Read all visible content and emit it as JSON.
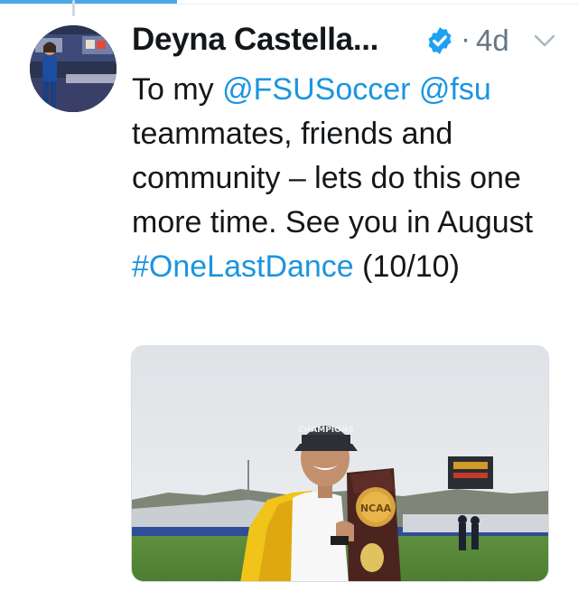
{
  "tweet": {
    "author_name": "Deyna Castella...",
    "verified_icon": "verified-badge-icon",
    "separator": "·",
    "timestamp": "4d",
    "menu_icon": "chevron-down-icon",
    "text_segments": [
      {
        "text": "To my ",
        "type": "text"
      },
      {
        "text": "@FSUSoccer",
        "type": "mention"
      },
      {
        "text": " ",
        "type": "text"
      },
      {
        "text": "@fsu",
        "type": "mention"
      },
      {
        "text": " teammates, friends and community – lets do this one more time. See you in August ",
        "type": "text"
      },
      {
        "text": "#OneLastDance",
        "type": "hashtag"
      },
      {
        "text": " (10/10)",
        "type": "text"
      }
    ],
    "media": {
      "trophy_label": "NCAA",
      "hat_text": "CHAMPIONS"
    }
  },
  "colors": {
    "link": "#1b95e0",
    "verified": "#1da1f2",
    "text": "#14171a",
    "muted": "#657786",
    "progress": "#4aa8e8"
  }
}
